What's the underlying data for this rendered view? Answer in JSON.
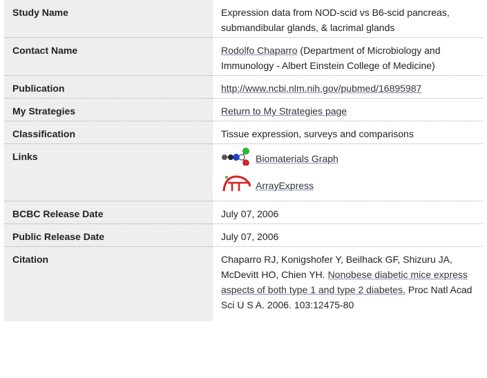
{
  "rows": {
    "study_name": {
      "label": "Study Name",
      "value": "Expression data from NOD-scid vs B6-scid pancreas, submandibular glands, & lacrimal glands"
    },
    "contact_name": {
      "label": "Contact Name",
      "link": "Rodolfo Chaparro",
      "value": " (Department of Microbiology and Immunology - Albert Einstein College of Medicine)"
    },
    "publication": {
      "label": "Publication",
      "link": "http://www.ncbi.nlm.nih.gov/pubmed/16895987"
    },
    "my_strategies": {
      "label": "My Strategies",
      "link": "Return to My Strategies page"
    },
    "classification": {
      "label": "Classification",
      "value": "Tissue expression, surveys and comparisons"
    },
    "links": {
      "label": "Links",
      "items": [
        {
          "label": "Biomaterials Graph",
          "icon": "biomaterials-graph-icon"
        },
        {
          "label": "ArrayExpress",
          "icon": "arrayexpress-logo-icon"
        }
      ]
    },
    "bcbc_release_date": {
      "label": "BCBC Release Date",
      "value": "July 07, 2006"
    },
    "public_release_date": {
      "label": "Public Release Date",
      "value": "July 07, 2006"
    },
    "citation": {
      "label": "Citation",
      "prefix": "Chaparro RJ, Konigshofer Y, Beilhack GF, Shizuru JA, McDevitt HO, Chien YH. ",
      "link": "Nonobese diabetic mice express aspects of both type 1 and type 2 diabetes.",
      "suffix": " Proc Natl Acad Sci U S A. 2006. 103:12475-80"
    }
  },
  "colors": {
    "label_bg": "#eeeeee",
    "row_divider": "#aaaaaa",
    "link_underline": "#7a90c0"
  }
}
